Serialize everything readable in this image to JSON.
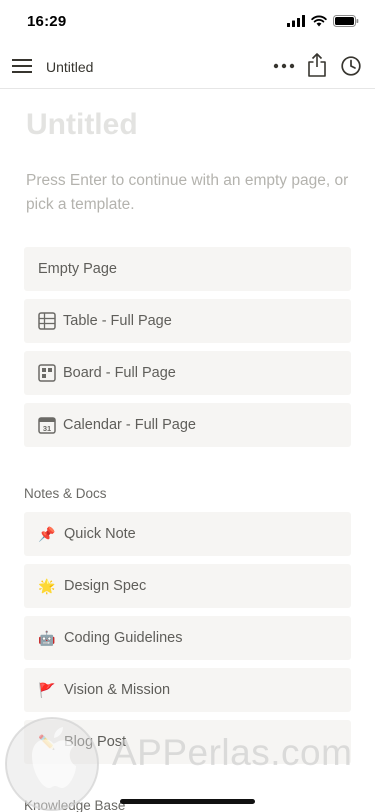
{
  "status": {
    "time": "16:29"
  },
  "nav": {
    "title": "Untitled"
  },
  "page": {
    "title": "Untitled",
    "hint": "Press Enter to continue with an empty page, or pick a template."
  },
  "templates": {
    "empty": "Empty Page",
    "table": "Table - Full Page",
    "board": "Board - Full Page",
    "calendar": "Calendar - Full Page",
    "calendar_icon_day": "31"
  },
  "sections": {
    "notes_docs": {
      "title": "Notes & Docs",
      "items": [
        {
          "label": "Quick Note",
          "emoji": "📌",
          "icon": "pushpin-icon"
        },
        {
          "label": "Design Spec",
          "emoji": "🌟",
          "icon": "glowing-star-icon"
        },
        {
          "label": "Coding Guidelines",
          "emoji": "🤖",
          "icon": "robot-icon"
        },
        {
          "label": "Vision & Mission",
          "emoji": "🚩",
          "icon": "flag-icon"
        },
        {
          "label": "Blog Post",
          "emoji": "✏️",
          "icon": "pencil-icon"
        }
      ]
    },
    "knowledge_base": {
      "title": "Knowledge Base"
    }
  },
  "watermark": {
    "text": "APPerlas.com"
  }
}
